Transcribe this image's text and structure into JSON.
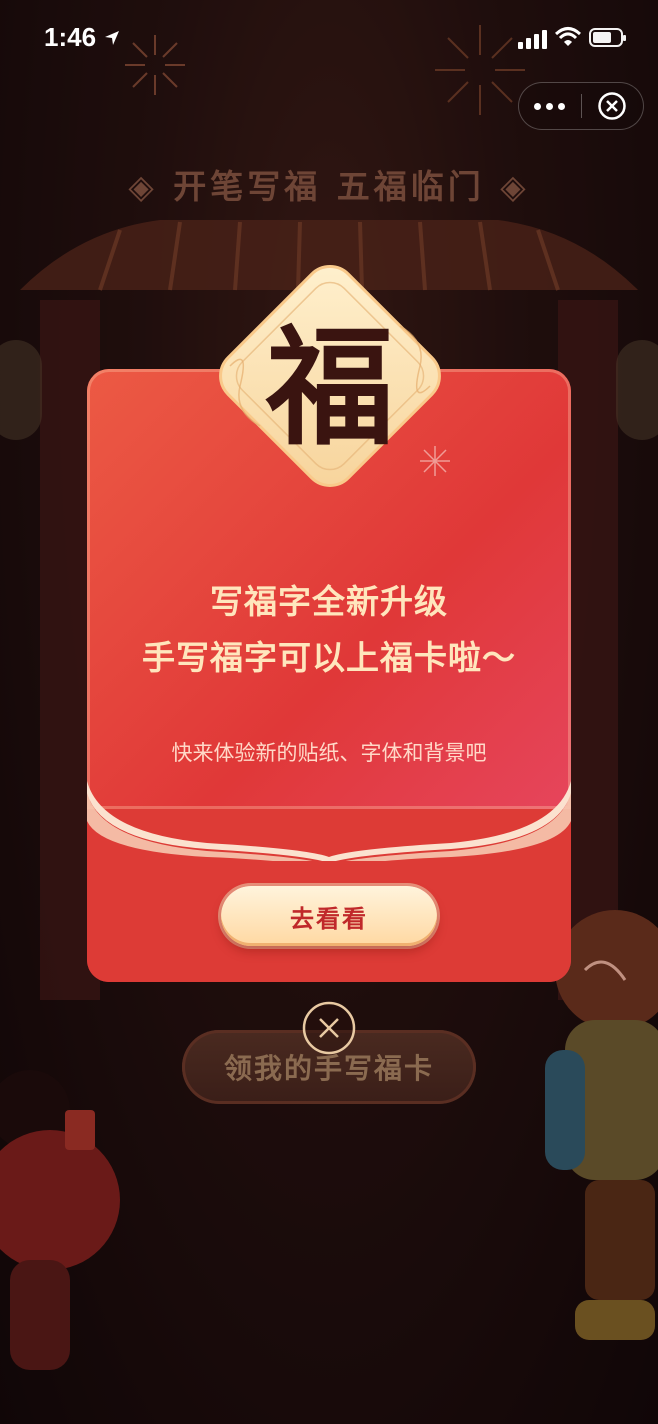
{
  "status_bar": {
    "time": "1:46",
    "battery_level": 0.7
  },
  "capsule": {
    "more_icon": "more-dots-icon",
    "close_icon": "close-circle-icon"
  },
  "background": {
    "banner_title": "◈ 开笔写福  五福临门 ◈",
    "button_label": "领我的手写福卡"
  },
  "modal": {
    "emblem_char": "福",
    "headline_line1": "写福字全新升级",
    "headline_line2": "手写福字可以上福卡啦～",
    "subtitle": "快来体验新的贴纸、字体和背景吧",
    "cta_label": "去看看",
    "close_icon": "close-circle-icon"
  },
  "colors": {
    "modal_red": "#e23a3a",
    "gold": "#ffe6bd",
    "cta_text": "#c0282a"
  }
}
